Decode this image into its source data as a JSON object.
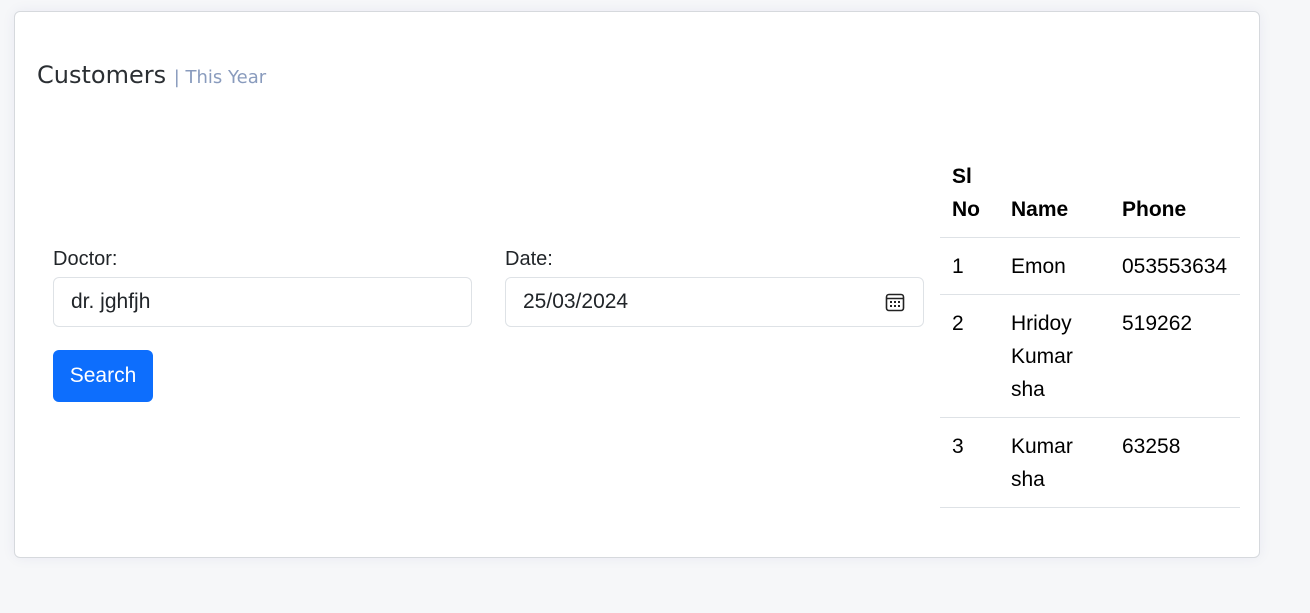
{
  "card": {
    "title": "Customers",
    "subtitle": "| This Year"
  },
  "form": {
    "doctor_label": "Doctor:",
    "doctor_value": "dr. jghfjh",
    "date_label": "Date:",
    "date_value": "25/03/2024",
    "search_label": "Search",
    "calendar_icon": "calendar-icon"
  },
  "table": {
    "headers": [
      "Sl No",
      "Name",
      "Phone"
    ],
    "rows": [
      {
        "sl": "1",
        "name": "Emon",
        "phone": "053553634"
      },
      {
        "sl": "2",
        "name": "Hridoy Kumar sha",
        "phone": "519262"
      },
      {
        "sl": "3",
        "name": "Kumar sha",
        "phone": "63258"
      }
    ]
  },
  "colors": {
    "primary": "#0d6efd",
    "subtitle": "#899bbd",
    "border": "#dee2e6"
  }
}
